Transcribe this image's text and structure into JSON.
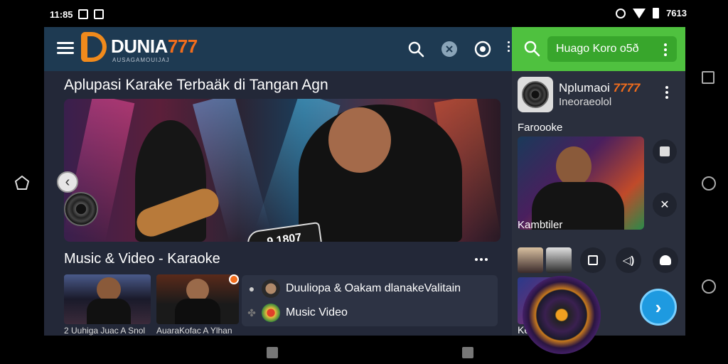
{
  "status_bar": {
    "time": "11:85",
    "battery_text": "7613"
  },
  "header": {
    "logo_main": "DUNIA",
    "logo_num": "777",
    "logo_sub": "AUSAGAMOUIJAJ",
    "icons": [
      "menu-icon",
      "search-icon",
      "shield-icon",
      "settings-icon",
      "more-icon"
    ]
  },
  "hero": {
    "title": "Aplupasi Karake Terbaäk di Tangan Agn",
    "tag_text": "9 1807"
  },
  "music_section": {
    "title": "Music & Video - Karaoke",
    "thumbnails": [
      {
        "caption": "2 Uuhiga Juac A Snol"
      },
      {
        "caption": "AuaraKofac A Ylhan"
      }
    ],
    "list": [
      {
        "text": "Duuliopa & Oakam dlanakeValitain"
      },
      {
        "text": "Music Video"
      }
    ]
  },
  "right_panel": {
    "search_text": "Huago Koro o5ð",
    "profile_title": "Nplumaoi",
    "profile_num": "7777",
    "profile_sub": "Ineoraeolol",
    "section1_label": "Faroooke",
    "section2_label": "Kambtiler",
    "section3_label": "Keanoalb"
  },
  "colors": {
    "topbar": "#1e3a52",
    "app_bg": "#232838",
    "panel_bg": "#2a2f3d",
    "green_bar": "#4fc13f",
    "accent_orange": "#f26d1c",
    "fab_blue": "#1e9ae0"
  }
}
